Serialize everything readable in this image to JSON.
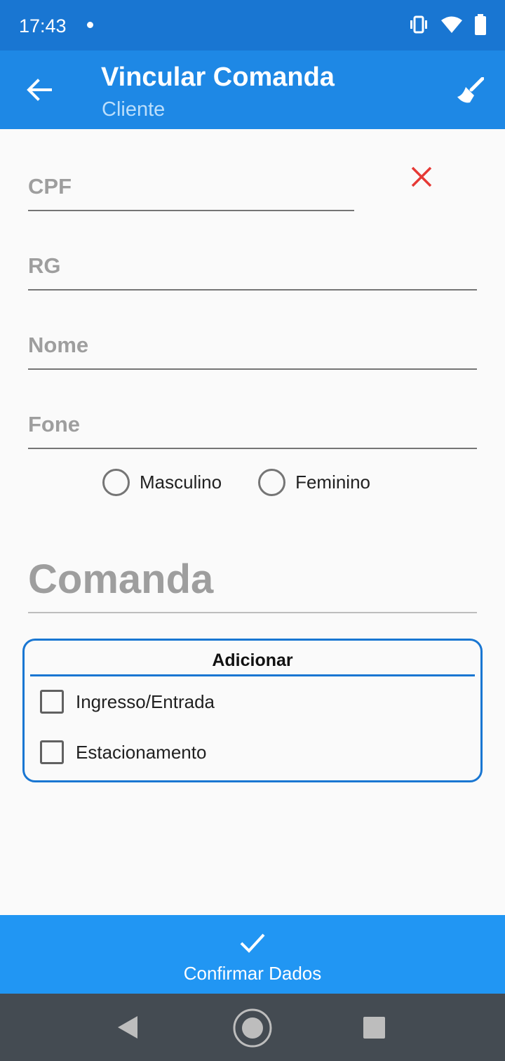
{
  "status_bar": {
    "time": "17:43"
  },
  "app_bar": {
    "title": "Vincular Comanda",
    "subtitle": "Cliente"
  },
  "form": {
    "cpf_label": "CPF",
    "rg_label": "RG",
    "nome_label": "Nome",
    "fone_label": "Fone",
    "gender_options": [
      "Masculino",
      "Feminino"
    ],
    "comanda_label": "Comanda"
  },
  "add_section": {
    "title": "Adicionar",
    "options": [
      "Ingresso/Entrada",
      "Estacionamento"
    ]
  },
  "confirm": {
    "label": "Confirmar Dados"
  },
  "colors": {
    "status_bar": "#1976d2",
    "app_bar": "#1e88e5",
    "confirm_button": "#2196f3",
    "clear_icon": "#e53935",
    "nav_bar": "#444b52"
  }
}
